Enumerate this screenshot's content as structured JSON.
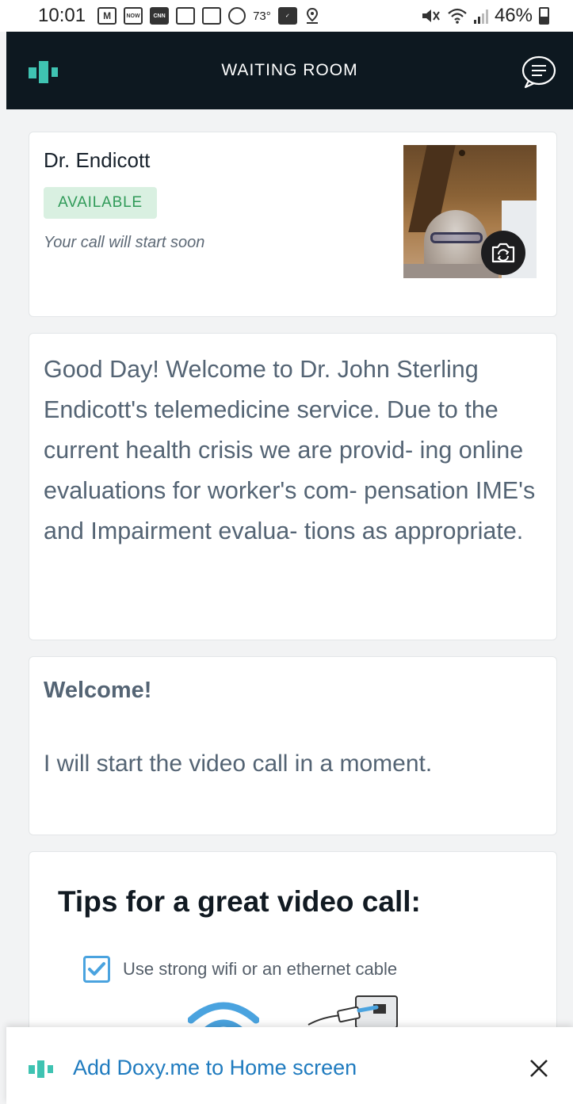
{
  "status_bar": {
    "time": "10:01",
    "notification_icons": [
      {
        "name": "mail-icon",
        "label": "M"
      },
      {
        "name": "weather-now-icon",
        "label": "NOW"
      },
      {
        "name": "cnn-icon",
        "label": "CNN"
      },
      {
        "name": "news-icon",
        "label": ""
      },
      {
        "name": "news-icon-2",
        "label": ""
      },
      {
        "name": "circle-icon",
        "label": ""
      }
    ],
    "temperature": "73°",
    "battery": "46%"
  },
  "header": {
    "title": "WAITING ROOM",
    "brand_color": "#3fc3b2",
    "background": "#0d1820"
  },
  "doctor_card": {
    "name": "Dr. Endicott",
    "status": "AVAILABLE",
    "note": "Your call will start soon"
  },
  "message_card": {
    "text": "Good Day! Welcome to Dr. John Sterling Endicott's telemedicine service. Due to the current health crisis we are provid- ing online evaluations for worker's com- pensation IME's and Impairment evalua- tions as appropriate."
  },
  "welcome_card": {
    "title": "Welcome!",
    "body": "I will start the video call in a moment."
  },
  "tips_card": {
    "title": "Tips for a great video call:",
    "tips": [
      {
        "text": "Use strong wifi or an ethernet cable",
        "checked": true
      }
    ]
  },
  "home_banner": {
    "text": "Add Doxy.me to Home screen",
    "link_color": "#1f7bbf"
  }
}
